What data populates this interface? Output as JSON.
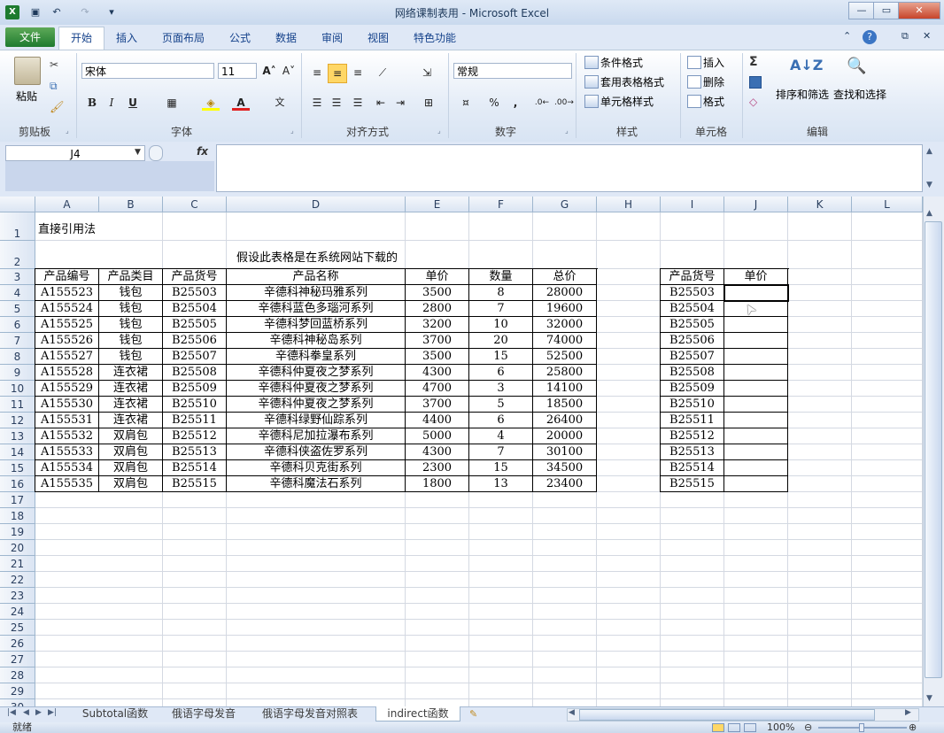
{
  "window": {
    "title": "网络课制表用 - Microsoft Excel",
    "app_icon": "excel-icon",
    "qat": [
      "save-icon",
      "undo-icon",
      "redo-icon",
      "customize-icon"
    ]
  },
  "tabs": {
    "file": "文件",
    "items": [
      "开始",
      "插入",
      "页面布局",
      "公式",
      "数据",
      "审阅",
      "视图",
      "特色功能"
    ],
    "active": "开始"
  },
  "ribbon": {
    "clipboard": {
      "paste": "粘贴",
      "label": "剪贴板"
    },
    "font": {
      "name": "宋体",
      "size": "11",
      "label": "字体",
      "bold": "B",
      "italic": "I",
      "underline": "U"
    },
    "alignment": {
      "label": "对齐方式"
    },
    "number": {
      "format": "常规",
      "label": "数字",
      "percent": "%",
      "comma": ","
    },
    "styles": {
      "conditional": "条件格式",
      "table": "套用表格格式",
      "cell": "单元格样式",
      "label": "样式"
    },
    "cells": {
      "insert": "插入",
      "delete": "删除",
      "format": "格式",
      "label": "单元格"
    },
    "editing": {
      "sort": "排序和筛选",
      "find": "查找和选择",
      "label": "编辑"
    }
  },
  "formula_bar": {
    "name_box": "J4",
    "fx": "fx",
    "value": ""
  },
  "columns": [
    "A",
    "B",
    "C",
    "D",
    "E",
    "F",
    "G",
    "H",
    "I",
    "J",
    "K",
    "L"
  ],
  "rows": [
    "1",
    "2",
    "3",
    "4",
    "5",
    "6",
    "7",
    "8",
    "9",
    "10",
    "11",
    "12",
    "13",
    "14",
    "15",
    "16",
    "17",
    "18",
    "19",
    "20",
    "21",
    "22",
    "23",
    "24",
    "25",
    "26",
    "27",
    "28",
    "29",
    "30"
  ],
  "sheet": {
    "a1": "直接引用法",
    "note": "假设此表格是在系统网站下载的",
    "headers": [
      "产品编号",
      "产品类目",
      "产品货号",
      "产品名称",
      "单价",
      "数量",
      "总价"
    ],
    "data": [
      [
        "A155523",
        "钱包",
        "B25503",
        "辛德科神秘玛雅系列",
        "3500",
        "8",
        "28000"
      ],
      [
        "A155524",
        "钱包",
        "B25504",
        "辛德科蓝色多瑙河系列",
        "2800",
        "7",
        "19600"
      ],
      [
        "A155525",
        "钱包",
        "B25505",
        "辛德科梦回蓝桥系列",
        "3200",
        "10",
        "32000"
      ],
      [
        "A155526",
        "钱包",
        "B25506",
        "辛德科神秘岛系列",
        "3700",
        "20",
        "74000"
      ],
      [
        "A155527",
        "钱包",
        "B25507",
        "辛德科拳皇系列",
        "3500",
        "15",
        "52500"
      ],
      [
        "A155528",
        "连衣裙",
        "B25508",
        "辛德科仲夏夜之梦系列",
        "4300",
        "6",
        "25800"
      ],
      [
        "A155529",
        "连衣裙",
        "B25509",
        "辛德科仲夏夜之梦系列",
        "4700",
        "3",
        "14100"
      ],
      [
        "A155530",
        "连衣裙",
        "B25510",
        "辛德科仲夏夜之梦系列",
        "3700",
        "5",
        "18500"
      ],
      [
        "A155531",
        "连衣裙",
        "B25511",
        "辛德科绿野仙踪系列",
        "4400",
        "6",
        "26400"
      ],
      [
        "A155532",
        "双肩包",
        "B25512",
        "辛德科尼加拉瀑布系列",
        "5000",
        "4",
        "20000"
      ],
      [
        "A155533",
        "双肩包",
        "B25513",
        "辛德科侠盗佐罗系列",
        "4300",
        "7",
        "30100"
      ],
      [
        "A155534",
        "双肩包",
        "B25514",
        "辛德科贝克街系列",
        "2300",
        "15",
        "34500"
      ],
      [
        "A155535",
        "双肩包",
        "B25515",
        "辛德科魔法石系列",
        "1800",
        "13",
        "23400"
      ]
    ],
    "lookup_headers": [
      "产品货号",
      "单价"
    ],
    "lookup_keys": [
      "B25503",
      "B25504",
      "B25505",
      "B25506",
      "B25507",
      "B25508",
      "B25509",
      "B25510",
      "B25511",
      "B25512",
      "B25513",
      "B25514",
      "B25515"
    ]
  },
  "sheet_tabs": [
    "Subtotal函数",
    "俄语字母发音",
    "俄语字母发音对照表",
    "indirect函数"
  ],
  "active_sheet": "indirect函数",
  "status": {
    "ready": "就绪",
    "zoom": "100%"
  }
}
